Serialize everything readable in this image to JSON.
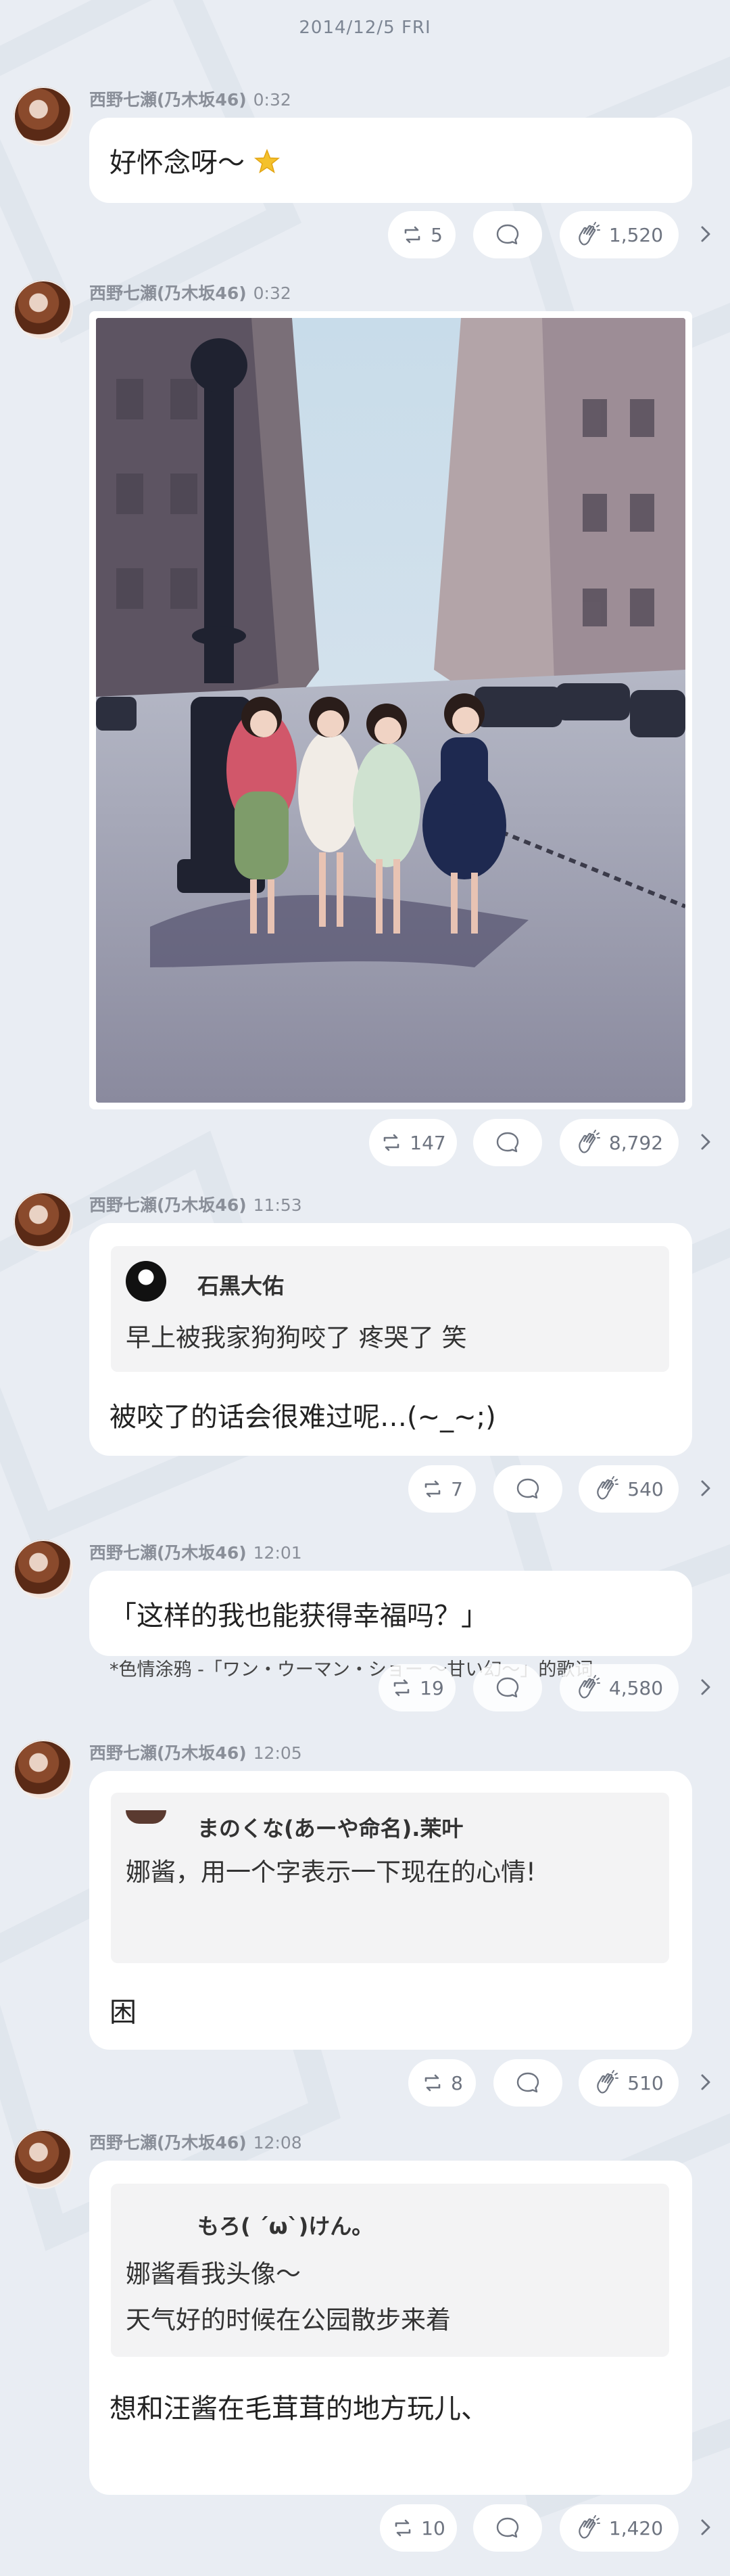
{
  "date_header": "2014/12/5 FRI",
  "colors": {
    "background": "#e9edf3",
    "card": "#ffffff",
    "muted_text": "#8a8f99",
    "quote_bg": "#f3f3f4"
  },
  "icons": {
    "repost": "repost-icon",
    "comment": "comment-icon",
    "clap": "clap-icon",
    "chevron": "chevron-right-icon"
  },
  "posts": [
    {
      "sender": "西野七瀬(乃木坂46)",
      "time": "0:32",
      "text": "好怀念呀〜",
      "emoji": "star-emoji",
      "reposts": "5",
      "claps": "1,520"
    },
    {
      "sender": "西野七瀬(乃木坂46)",
      "time": "0:32",
      "photo": "photo-four-girls-paris-street",
      "reposts": "147",
      "claps": "8,792"
    },
    {
      "sender": "西野七瀬(乃木坂46)",
      "time": "11:53",
      "quote_name": "石黒大佑",
      "quote_text": "早上被我家狗狗咬了 疼哭了 笑",
      "text": "被咬了的话会很难过呢…(~_~;)",
      "reposts": "7",
      "claps": "540"
    },
    {
      "sender": "西野七瀬(乃木坂46)",
      "time": "12:01",
      "text": "「这样的我也能获得幸福吗？」",
      "caption": "*色情涂鸦 -「ワン・ウーマン・ショー 〜甘い幻〜」的歌词",
      "reposts": "19",
      "claps": "4,580"
    },
    {
      "sender": "西野七瀬(乃木坂46)",
      "time": "12:05",
      "quote_name": "まのくな(あーや命名).茉叶",
      "quote_text": "娜酱，用一个字表示一下现在的心情!",
      "text": "困",
      "reposts": "8",
      "claps": "510"
    },
    {
      "sender": "西野七瀬(乃木坂46)",
      "time": "12:08",
      "quote_name": "もろ( ´ω`)けん。",
      "quote_line1": "娜酱看我头像〜",
      "quote_line2": "天气好的时候在公园散步来着",
      "text": "想和汪酱在毛茸茸的地方玩儿、",
      "reposts": "10",
      "claps": "1,420"
    }
  ]
}
